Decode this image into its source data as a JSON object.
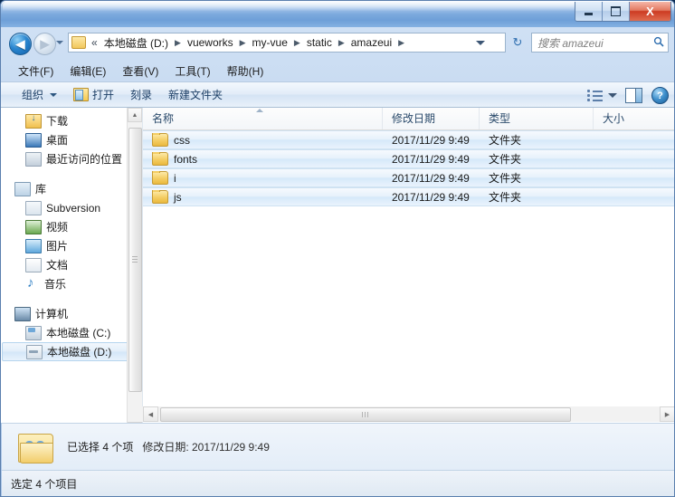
{
  "window": {
    "controls": {
      "minimize_label": "—",
      "maximize_label": "❐",
      "close_label": "X"
    }
  },
  "address_bar": {
    "back_label": "◀",
    "forward_label": "▶",
    "history_label": "▾",
    "double_chevron": "«",
    "folder_icon": "folder-icon",
    "separator": "▶",
    "crumbs": [
      "本地磁盘 (D:)",
      "vueworks",
      "my-vue",
      "static",
      "amazeui"
    ],
    "dropdown_label": "▾",
    "refresh_label": "↻",
    "search": {
      "placeholder": "搜索 amazeui",
      "icon": "search-icon"
    }
  },
  "menubar": {
    "items": [
      "文件(F)",
      "编辑(E)",
      "查看(V)",
      "工具(T)",
      "帮助(H)"
    ]
  },
  "toolbar": {
    "organize_label": "组织",
    "open_label": "打开",
    "burn_label": "刻录",
    "new_folder_label": "新建文件夹",
    "view_icon": "view-mode-icon",
    "view_caret": "▾",
    "preview_pane_icon": "preview-pane-icon",
    "help_icon": "help-icon",
    "help_label": "?"
  },
  "sidebar": {
    "groups": [
      {
        "items": [
          {
            "label": "下载",
            "icon": "download-icon",
            "kind": "child",
            "selected": false
          },
          {
            "label": "桌面",
            "icon": "desktop-icon",
            "kind": "child",
            "selected": false
          },
          {
            "label": "最近访问的位置",
            "icon": "recent-places-icon",
            "kind": "child",
            "selected": false
          }
        ]
      },
      {
        "items": [
          {
            "label": "库",
            "icon": "library-icon",
            "kind": "group",
            "selected": false
          },
          {
            "label": "Subversion",
            "icon": "subversion-icon",
            "kind": "child",
            "selected": false
          },
          {
            "label": "视频",
            "icon": "videos-icon",
            "kind": "child",
            "selected": false
          },
          {
            "label": "图片",
            "icon": "pictures-icon",
            "kind": "child",
            "selected": false
          },
          {
            "label": "文档",
            "icon": "documents-icon",
            "kind": "child",
            "selected": false
          },
          {
            "label": "音乐",
            "icon": "music-icon",
            "kind": "child",
            "selected": false
          }
        ]
      },
      {
        "items": [
          {
            "label": "计算机",
            "icon": "computer-icon",
            "kind": "group",
            "selected": false
          },
          {
            "label": "本地磁盘 (C:)",
            "icon": "drive-c-icon",
            "kind": "child",
            "selected": false
          },
          {
            "label": "本地磁盘 (D:)",
            "icon": "drive-d-icon",
            "kind": "child",
            "selected": true
          }
        ]
      }
    ],
    "scroll_up_label": "▲",
    "scroll_down_label": "▼"
  },
  "file_list": {
    "columns": [
      {
        "label": "名称",
        "key": "name"
      },
      {
        "label": "修改日期",
        "key": "date"
      },
      {
        "label": "类型",
        "key": "type"
      },
      {
        "label": "大小",
        "key": "size"
      }
    ],
    "sort_column": "名称",
    "sort_direction": "asc",
    "rows": [
      {
        "name": "css",
        "date": "2017/11/29 9:49",
        "type": "文件夹",
        "size": "",
        "icon": "folder-icon",
        "selected": true
      },
      {
        "name": "fonts",
        "date": "2017/11/29 9:49",
        "type": "文件夹",
        "size": "",
        "icon": "folder-icon",
        "selected": true
      },
      {
        "name": "i",
        "date": "2017/11/29 9:49",
        "type": "文件夹",
        "size": "",
        "icon": "folder-icon",
        "selected": true
      },
      {
        "name": "js",
        "date": "2017/11/29 9:49",
        "type": "文件夹",
        "size": "",
        "icon": "folder-icon",
        "selected": true
      }
    ],
    "hscroll_left_label": "◀",
    "hscroll_right_label": "▶"
  },
  "details_pane": {
    "icon": "multiple-folders-icon",
    "primary": "已选择 4 个项",
    "secondary": "修改日期: 2017/11/29 9:49"
  },
  "status_bar": {
    "text": "选定 4 个项目"
  }
}
